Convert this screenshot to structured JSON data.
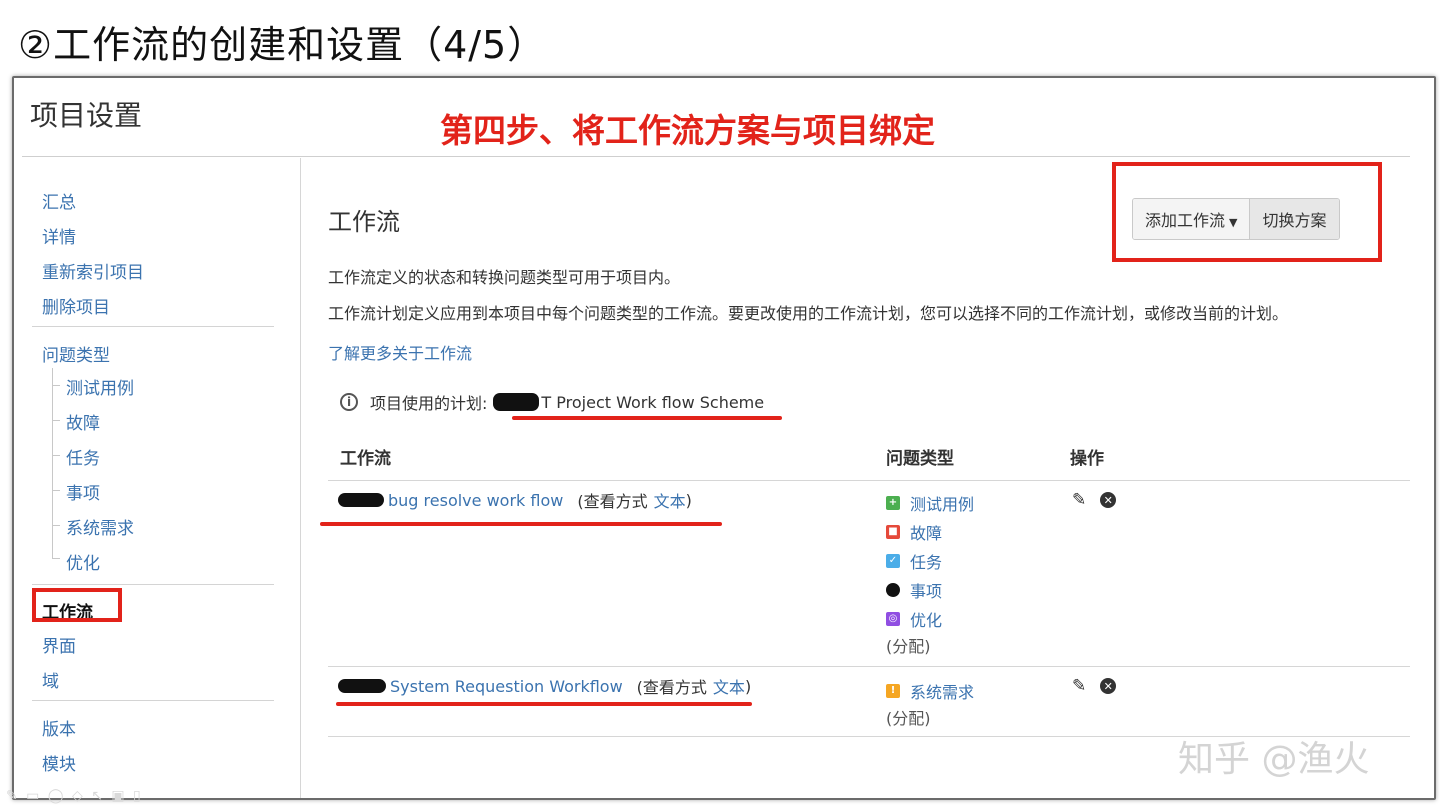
{
  "slide": {
    "title": "②工作流的创建和设置（4/5）"
  },
  "panel": {
    "title": "项目设置",
    "step_banner": "第四步、将工作流方案与项目绑定"
  },
  "sidebar": {
    "items": [
      {
        "label": "汇总"
      },
      {
        "label": "详情"
      },
      {
        "label": "重新索引项目"
      },
      {
        "label": "删除项目"
      },
      {
        "label": "问题类型"
      },
      {
        "label": "测试用例"
      },
      {
        "label": "故障"
      },
      {
        "label": "任务"
      },
      {
        "label": "事项"
      },
      {
        "label": "系统需求"
      },
      {
        "label": "优化"
      },
      {
        "label": "工作流"
      },
      {
        "label": "界面"
      },
      {
        "label": "域"
      },
      {
        "label": "版本"
      },
      {
        "label": "模块"
      }
    ]
  },
  "main": {
    "title": "工作流",
    "add_workflow_label": "添加工作流",
    "switch_scheme_label": "切换方案",
    "desc1": "工作流定义的状态和转换问题类型可用于项目内。",
    "desc2": "工作流计划定义应用到本项目中每个问题类型的工作流。要更改使用的工作流计划，您可以选择不同的工作流计划，或修改当前的计划。",
    "learn_more": "了解更多关于工作流",
    "scheme_label": "项目使用的计划:",
    "scheme_name": "T Project Work flow Scheme",
    "columns": [
      "工作流",
      "问题类型",
      "操作"
    ],
    "workflows": [
      {
        "name": "bug resolve work flow",
        "view_prefix": "(查看方式",
        "view_link": "文本",
        "view_suffix": ")",
        "issue_types": [
          "测试用例",
          "故障",
          "任务",
          "事项",
          "优化"
        ],
        "assigned": "(分配)"
      },
      {
        "name": "System Requestion Workflow",
        "view_prefix": "(查看方式",
        "view_link": "文本",
        "view_suffix": ")",
        "issue_types": [
          "系统需求"
        ],
        "assigned": "(分配)"
      }
    ]
  },
  "colors": {
    "accent_red": "#e2231a",
    "link_blue": "#3b73af",
    "test_case": "#4caf50",
    "bug": "#e5493a",
    "task": "#4bade8",
    "improvement": "#904ee2",
    "requirement": "#f5a623"
  },
  "watermark": "知乎 @渔火"
}
